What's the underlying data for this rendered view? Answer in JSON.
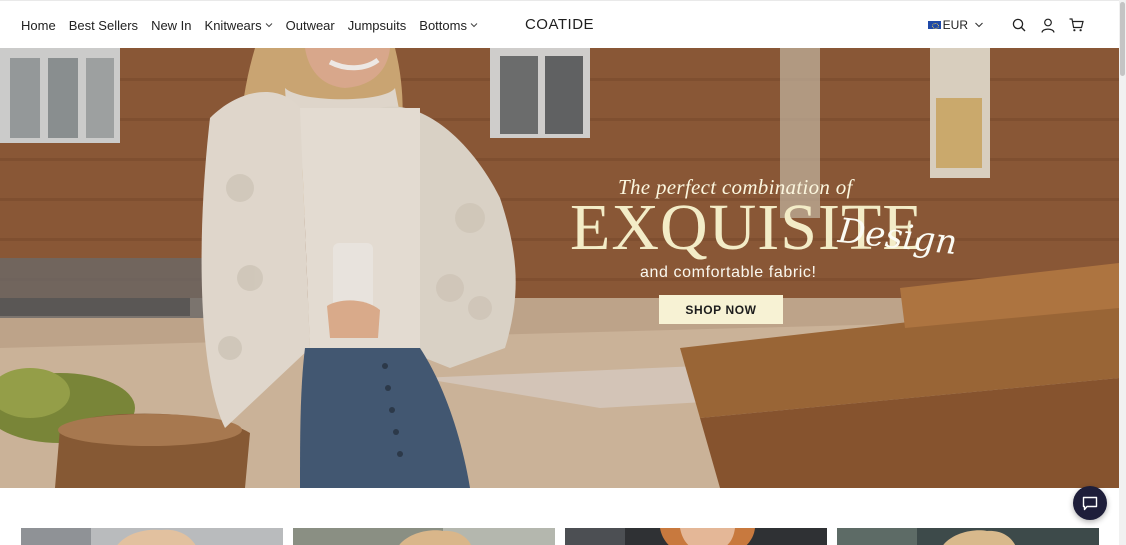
{
  "nav": {
    "items": [
      {
        "label": "Home",
        "has_dropdown": false
      },
      {
        "label": "Best Sellers",
        "has_dropdown": false
      },
      {
        "label": "New In",
        "has_dropdown": false
      },
      {
        "label": "Knitwears",
        "has_dropdown": true
      },
      {
        "label": "Outwear",
        "has_dropdown": false
      },
      {
        "label": "Jumpsuits",
        "has_dropdown": false
      },
      {
        "label": "Bottoms",
        "has_dropdown": true
      }
    ]
  },
  "brand": {
    "logo_text": "COATIDE"
  },
  "header_right": {
    "currency": "EUR",
    "icons": [
      "flag-eu-icon",
      "chevron-down-icon",
      "search-icon",
      "account-icon",
      "cart-icon"
    ]
  },
  "hero": {
    "tagline": "The perfect combination of",
    "headline": "EXQUISITE",
    "script_word": "Design",
    "subline": "and comfortable fabric!",
    "cta_label": "SHOP NOW"
  },
  "colors": {
    "cta_background": "#f7f2d4",
    "headline": "#f3ecc7",
    "chat_bubble": "#1e1e3a"
  },
  "product_cards_visible": 4,
  "chat": {
    "icon": "chat-bubble-icon"
  }
}
